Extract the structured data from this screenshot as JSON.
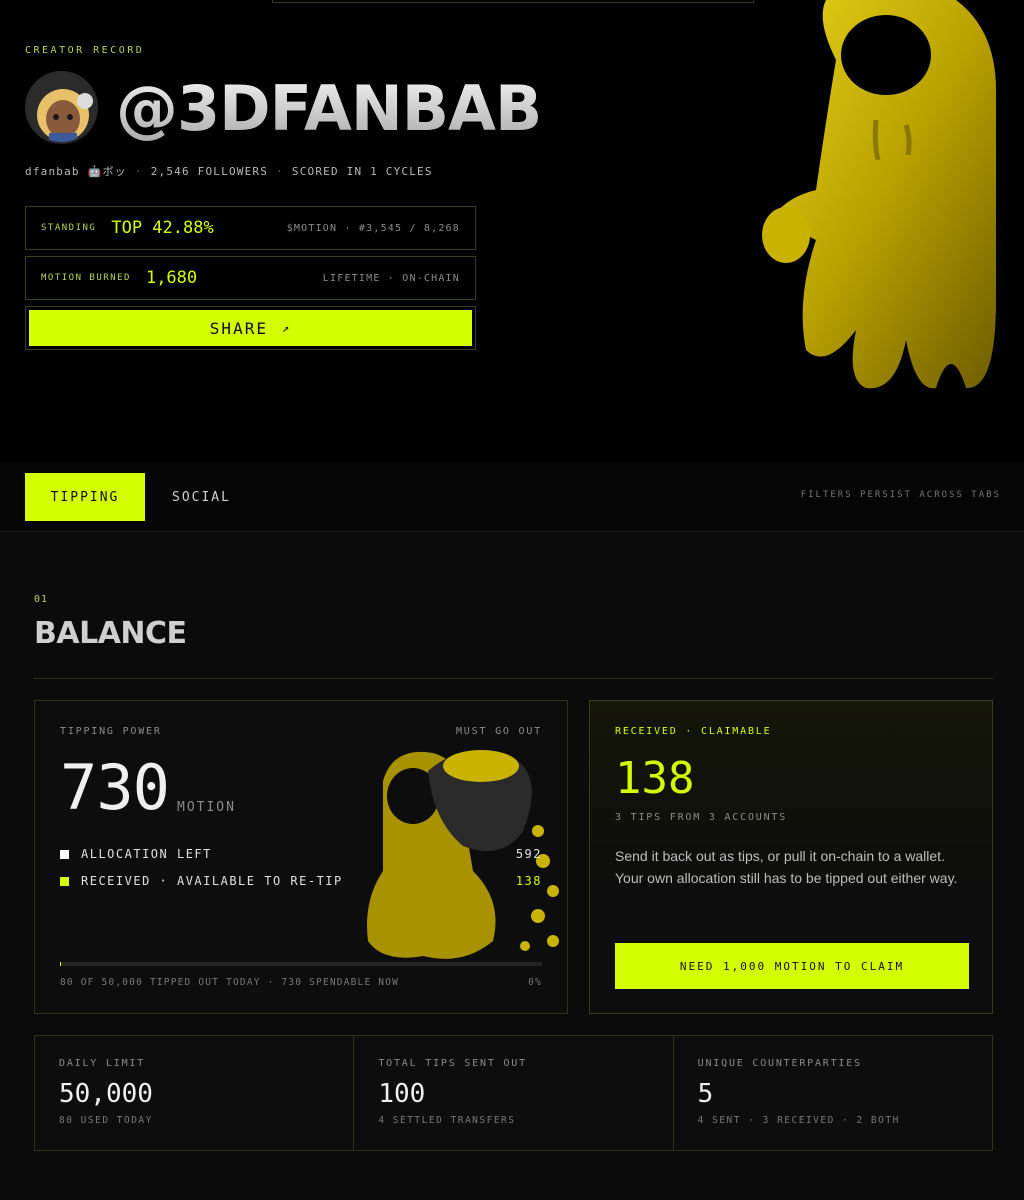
{
  "header": {
    "eyebrow": "CREATOR RECORD",
    "handle": "@3DFANBAB",
    "meta": {
      "username": "dfanbab 🤖ボッ",
      "followers": "2,546 FOLLOWERS",
      "cycles": "SCORED IN 1 CYCLES"
    },
    "standing": {
      "label": "STANDING",
      "value": "TOP 42.88%",
      "detail": "$MOTION · #3,545 / 8,268"
    },
    "burned": {
      "label": "MOTION BURNED",
      "value": "1,680",
      "detail": "LIFETIME · ON-CHAIN"
    },
    "share_label": "SHARE",
    "share_icon": "↗"
  },
  "tabs": {
    "active": "TIPPING",
    "other": "SOCIAL",
    "note": "FILTERS PERSIST ACROSS TABS"
  },
  "balance": {
    "section_number": "01",
    "title": "BALANCE",
    "power": {
      "label": "TIPPING POWER",
      "badge": "MUST GO OUT",
      "value": "730",
      "unit": "MOTION",
      "rows": [
        {
          "label": "ALLOCATION LEFT",
          "value": "592",
          "color": "#ffffff"
        },
        {
          "label": "RECEIVED · AVAILABLE TO RE-TIP",
          "value": "138",
          "color": "#d4ff00"
        }
      ],
      "progress_fraction": 0.0016,
      "footer_left": "80 OF 50,000 TIPPED OUT TODAY · 730 SPENDABLE NOW",
      "footer_right": "0%"
    },
    "received": {
      "label": "RECEIVED · CLAIMABLE",
      "value": "138",
      "sub": "3 TIPS FROM 3 ACCOUNTS",
      "description": "Send it back out as tips, or pull it on-chain to a wallet. Your own allocation still has to be tipped out either way.",
      "button": "NEED 1,000 MOTION TO CLAIM"
    },
    "stats": [
      {
        "title": "DAILY LIMIT",
        "value": "50,000",
        "sub": "80 USED TODAY"
      },
      {
        "title": "TOTAL TIPS SENT OUT",
        "value": "100",
        "sub": "4 SETTLED TRANSFERS"
      },
      {
        "title": "UNIQUE COUNTERPARTIES",
        "value": "5",
        "sub": "4 SENT · 3 RECEIVED · 2 BOTH"
      }
    ]
  },
  "colors": {
    "accent": "#d4ff00",
    "mascot": "#c9b200",
    "background": "#000000"
  },
  "icons": [
    "avatar",
    "share-arrow-icon",
    "mascot-figure",
    "mascot-coin-bag"
  ]
}
